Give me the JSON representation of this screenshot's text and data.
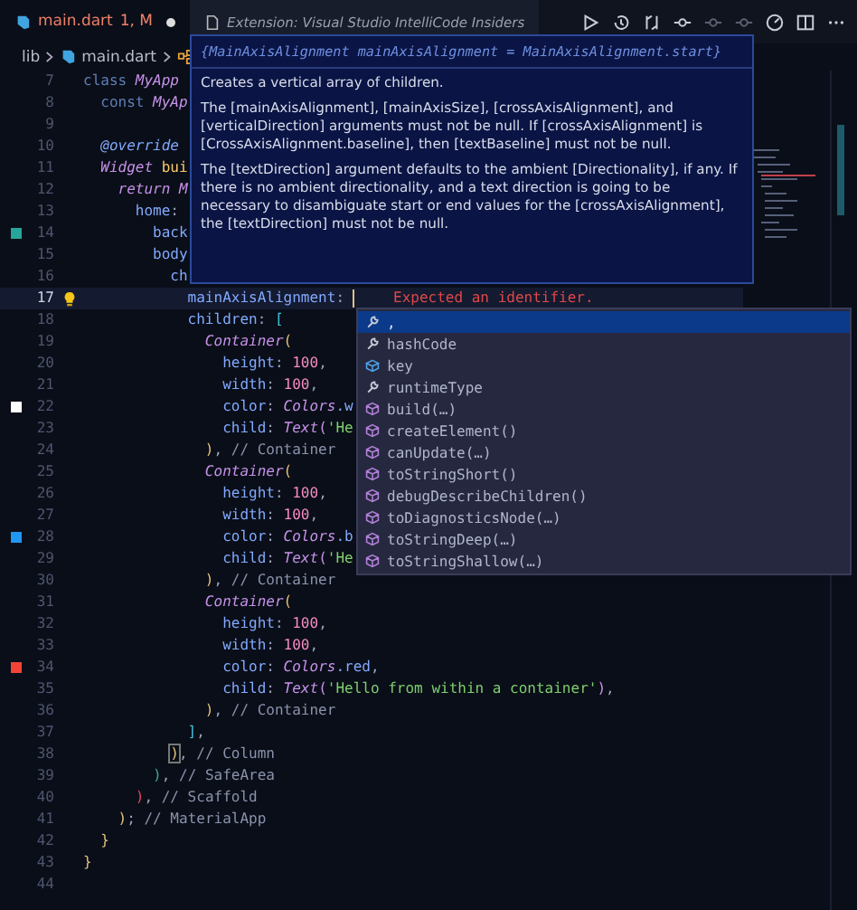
{
  "tabs": [
    {
      "kind": "dart",
      "label": "main.dart",
      "badge": "1, M",
      "modified": true,
      "selected": true
    },
    {
      "kind": "doc",
      "label": "Extension: Visual Studio IntelliCode Insiders",
      "modified": false,
      "selected": false
    }
  ],
  "toolbar": [
    {
      "kind": "play"
    },
    {
      "kind": "history"
    },
    {
      "kind": "compare"
    },
    {
      "kind": "commit"
    },
    {
      "kind": "commit-dim"
    },
    {
      "kind": "commit-dim"
    },
    {
      "kind": "gauge"
    },
    {
      "kind": "split"
    },
    {
      "kind": "more"
    }
  ],
  "breadcrumb": [
    {
      "kind": "folder",
      "label": "lib"
    },
    {
      "kind": "dart",
      "label": "main.dart"
    },
    {
      "kind": "class"
    }
  ],
  "lines": [
    {
      "n": "7",
      "s": [
        {
          "kind": "kw",
          "text": "class "
        },
        {
          "kind": "cls",
          "text": "MyApp"
        }
      ]
    },
    {
      "n": "8",
      "s": [
        {
          "kind": "kw",
          "text": "  const "
        },
        {
          "kind": "cls",
          "text": "MyAp"
        }
      ]
    },
    {
      "n": "9"
    },
    {
      "n": "10",
      "s": [
        {
          "kind": "dec",
          "text": "  @override"
        }
      ]
    },
    {
      "n": "11",
      "s": [
        {
          "kind": "cls",
          "text": "  Widget "
        },
        {
          "kind": "fn",
          "text": "bui"
        }
      ]
    },
    {
      "n": "12",
      "s": [
        {
          "kind": "cls",
          "text": "    return M"
        }
      ]
    },
    {
      "n": "13",
      "s": [
        {
          "kind": "prop",
          "text": "      home"
        },
        {
          "kind": "txt",
          "text": ":"
        }
      ]
    },
    {
      "n": "14",
      "s": [
        {
          "kind": "prop",
          "text": "        back"
        }
      ],
      "marker": {
        "color": "#26a69a"
      }
    },
    {
      "n": "15",
      "s": [
        {
          "kind": "prop",
          "text": "        body"
        }
      ]
    },
    {
      "n": "16",
      "s": [
        {
          "kind": "prop",
          "text": "          ch"
        }
      ]
    },
    {
      "n": "17",
      "s": [
        {
          "kind": "prop",
          "text": "            mainAxisAlignment"
        },
        {
          "kind": "txt",
          "text": ":"
        }
      ],
      "current": true,
      "lightbulb": true,
      "error": "Expected an identifier."
    },
    {
      "n": "18",
      "s": [
        {
          "kind": "prop",
          "text": "            children"
        },
        {
          "kind": "txt",
          "text": ": "
        },
        {
          "kind": "p3",
          "text": "["
        }
      ]
    },
    {
      "n": "19",
      "s": [
        {
          "kind": "cls",
          "text": "              Container"
        },
        {
          "kind": "p1",
          "text": "("
        }
      ]
    },
    {
      "n": "20",
      "s": [
        {
          "kind": "prop",
          "text": "                height"
        },
        {
          "kind": "txt",
          "text": ": "
        },
        {
          "kind": "num",
          "text": "100"
        },
        {
          "kind": "txt",
          "text": ","
        }
      ]
    },
    {
      "n": "21",
      "s": [
        {
          "kind": "prop",
          "text": "                width"
        },
        {
          "kind": "txt",
          "text": ": "
        },
        {
          "kind": "num",
          "text": "100"
        },
        {
          "kind": "txt",
          "text": ","
        }
      ]
    },
    {
      "n": "22",
      "s": [
        {
          "kind": "prop",
          "text": "                color"
        },
        {
          "kind": "txt",
          "text": ": "
        },
        {
          "kind": "cls",
          "text": "Colors"
        },
        {
          "kind": "prop",
          "text": ".w"
        }
      ],
      "marker": {
        "color": "#ffffff"
      }
    },
    {
      "n": "23",
      "s": [
        {
          "kind": "prop",
          "text": "                child"
        },
        {
          "kind": "txt",
          "text": ": "
        },
        {
          "kind": "cls",
          "text": "Text"
        },
        {
          "kind": "p2",
          "text": "("
        },
        {
          "kind": "str",
          "text": "'He"
        }
      ]
    },
    {
      "n": "24",
      "s": [
        {
          "kind": "p1",
          "text": "              )"
        },
        {
          "kind": "txt",
          "text": ", "
        },
        {
          "kind": "com",
          "text": "// Container"
        }
      ]
    },
    {
      "n": "25",
      "s": [
        {
          "kind": "cls",
          "text": "              Container"
        },
        {
          "kind": "p1",
          "text": "("
        }
      ]
    },
    {
      "n": "26",
      "s": [
        {
          "kind": "prop",
          "text": "                height"
        },
        {
          "kind": "txt",
          "text": ": "
        },
        {
          "kind": "num",
          "text": "100"
        },
        {
          "kind": "txt",
          "text": ","
        }
      ]
    },
    {
      "n": "27",
      "s": [
        {
          "kind": "prop",
          "text": "                width"
        },
        {
          "kind": "txt",
          "text": ": "
        },
        {
          "kind": "num",
          "text": "100"
        },
        {
          "kind": "txt",
          "text": ","
        }
      ]
    },
    {
      "n": "28",
      "s": [
        {
          "kind": "prop",
          "text": "                color"
        },
        {
          "kind": "txt",
          "text": ": "
        },
        {
          "kind": "cls",
          "text": "Colors"
        },
        {
          "kind": "prop",
          "text": ".b"
        }
      ],
      "marker": {
        "color": "#2196f3"
      }
    },
    {
      "n": "29",
      "s": [
        {
          "kind": "prop",
          "text": "                child"
        },
        {
          "kind": "txt",
          "text": ": "
        },
        {
          "kind": "cls",
          "text": "Text"
        },
        {
          "kind": "p2",
          "text": "("
        },
        {
          "kind": "str",
          "text": "'He"
        }
      ]
    },
    {
      "n": "30",
      "s": [
        {
          "kind": "p1",
          "text": "              )"
        },
        {
          "kind": "txt",
          "text": ", "
        },
        {
          "kind": "com",
          "text": "// Container"
        }
      ]
    },
    {
      "n": "31",
      "s": [
        {
          "kind": "cls",
          "text": "              Container"
        },
        {
          "kind": "p1",
          "text": "("
        }
      ]
    },
    {
      "n": "32",
      "s": [
        {
          "kind": "prop",
          "text": "                height"
        },
        {
          "kind": "txt",
          "text": ": "
        },
        {
          "kind": "num",
          "text": "100"
        },
        {
          "kind": "txt",
          "text": ","
        }
      ]
    },
    {
      "n": "33",
      "s": [
        {
          "kind": "prop",
          "text": "                width"
        },
        {
          "kind": "txt",
          "text": ": "
        },
        {
          "kind": "num",
          "text": "100"
        },
        {
          "kind": "txt",
          "text": ","
        }
      ]
    },
    {
      "n": "34",
      "s": [
        {
          "kind": "prop",
          "text": "                color"
        },
        {
          "kind": "txt",
          "text": ": "
        },
        {
          "kind": "cls",
          "text": "Colors"
        },
        {
          "kind": "prop",
          "text": ".red"
        },
        {
          "kind": "txt",
          "text": ","
        }
      ],
      "marker": {
        "color": "#f44336"
      }
    },
    {
      "n": "35",
      "s": [
        {
          "kind": "prop",
          "text": "                child"
        },
        {
          "kind": "txt",
          "text": ": "
        },
        {
          "kind": "cls",
          "text": "Text"
        },
        {
          "kind": "p2",
          "text": "("
        },
        {
          "kind": "str",
          "text": "'Hello from within a container'"
        },
        {
          "kind": "p2",
          "text": ")"
        },
        {
          "kind": "txt",
          "text": ","
        }
      ]
    },
    {
      "n": "36",
      "s": [
        {
          "kind": "p1",
          "text": "              )"
        },
        {
          "kind": "txt",
          "text": ", "
        },
        {
          "kind": "com",
          "text": "// Container"
        }
      ]
    },
    {
      "n": "37",
      "s": [
        {
          "kind": "p3",
          "text": "            ]"
        },
        {
          "kind": "txt",
          "text": ","
        }
      ]
    },
    {
      "n": "38",
      "s": [
        {
          "kind": "match",
          "text": "          )"
        },
        {
          "kind": "txt",
          "text": ", "
        },
        {
          "kind": "com",
          "text": "// Column"
        }
      ]
    },
    {
      "n": "39",
      "s": [
        {
          "kind": "p4",
          "text": "        )"
        },
        {
          "kind": "txt",
          "text": ", "
        },
        {
          "kind": "com",
          "text": "// SafeArea"
        }
      ]
    },
    {
      "n": "40",
      "s": [
        {
          "kind": "p5",
          "text": "      )"
        },
        {
          "kind": "txt",
          "text": ", "
        },
        {
          "kind": "com",
          "text": "// Scaffold"
        }
      ]
    },
    {
      "n": "41",
      "s": [
        {
          "kind": "p1",
          "text": "    )"
        },
        {
          "kind": "txt",
          "text": "; "
        },
        {
          "kind": "com",
          "text": "// MaterialApp"
        }
      ]
    },
    {
      "n": "42",
      "s": [
        {
          "kind": "p1",
          "text": "  }"
        }
      ]
    },
    {
      "n": "43",
      "s": [
        {
          "kind": "p1",
          "text": "}"
        }
      ]
    },
    {
      "n": "44"
    }
  ],
  "hover": {
    "signature": "{MainAxisAlignment mainAxisAlignment = MainAxisAlignment.start}",
    "paragraphs": [
      "Creates a vertical array of children.",
      "The [mainAxisAlignment], [mainAxisSize], [crossAxisAlignment], and [verticalDirection] arguments must not be null. If [crossAxisAlignment] is [CrossAxisAlignment.baseline], then [textBaseline] must not be null.",
      "The [textDirection] argument defaults to the ambient [Directionality], if any. If there is no ambient directionality, and a text direction is going to be necessary to disambiguate start or end values for the [crossAxisAlignment], the [textDirection] must not be null."
    ]
  },
  "suggestions": [
    {
      "kind": "field",
      "label": ",",
      "selected": true
    },
    {
      "kind": "field",
      "label": "hashCode",
      "selected": false
    },
    {
      "kind": "property",
      "label": "key",
      "selected": false
    },
    {
      "kind": "field",
      "label": "runtimeType",
      "selected": false
    },
    {
      "kind": "method",
      "label": "build(…)",
      "selected": false
    },
    {
      "kind": "method",
      "label": "createElement()",
      "selected": false
    },
    {
      "kind": "method",
      "label": "canUpdate(…)",
      "selected": false
    },
    {
      "kind": "method",
      "label": "toStringShort()",
      "selected": false
    },
    {
      "kind": "method",
      "label": "debugDescribeChildren()",
      "selected": false
    },
    {
      "kind": "method",
      "label": "toDiagnosticsNode(…)",
      "selected": false
    },
    {
      "kind": "method",
      "label": "toStringDeep(…)",
      "selected": false
    },
    {
      "kind": "method",
      "label": "toStringShallow(…)",
      "selected": false
    }
  ]
}
